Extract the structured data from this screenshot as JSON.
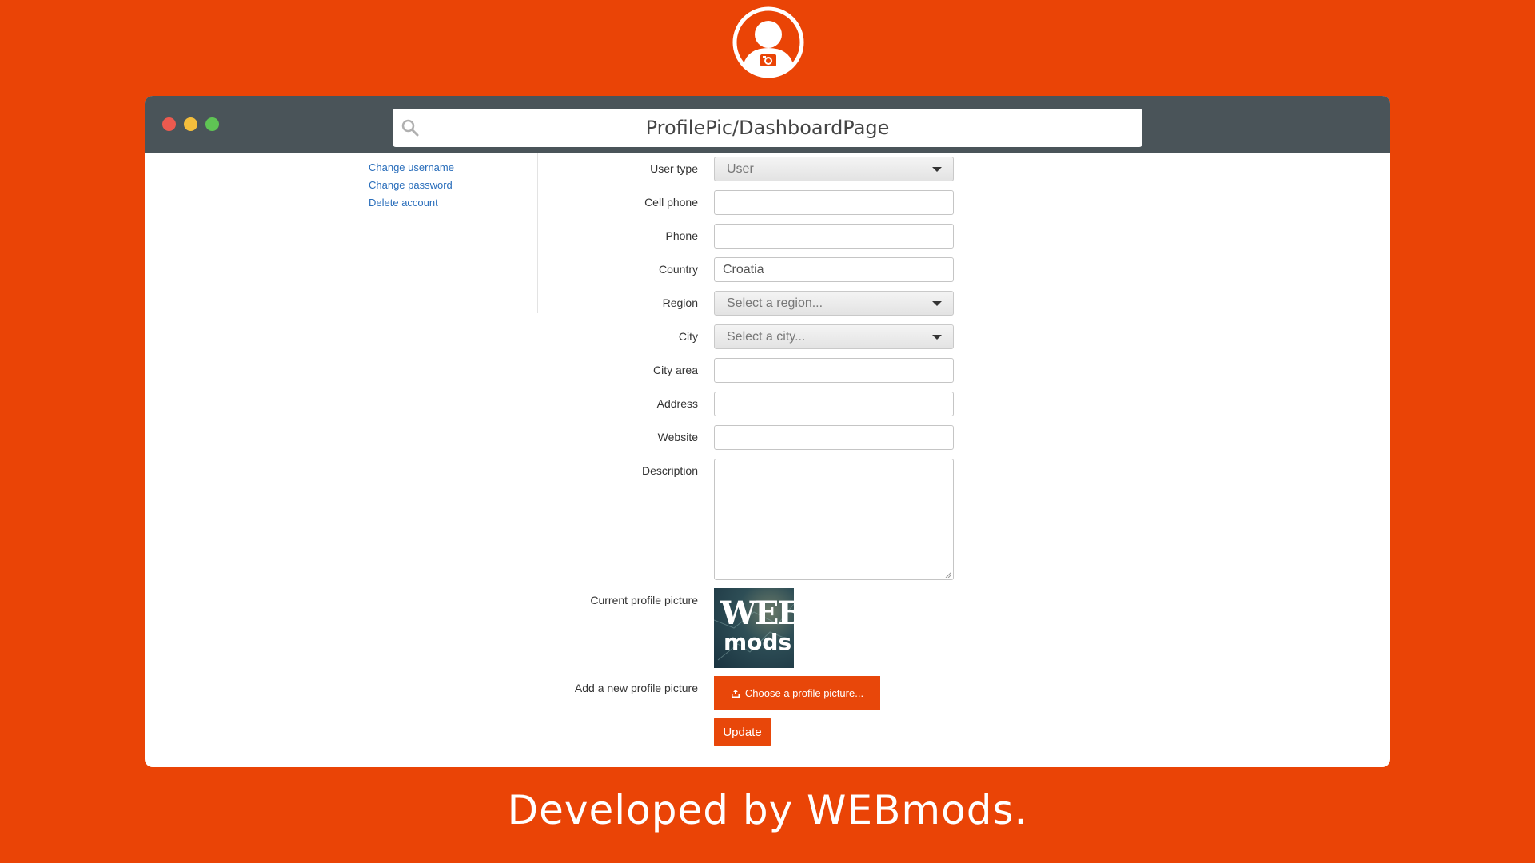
{
  "browser": {
    "url": "ProfilePic/DashboardPage"
  },
  "sidebar": {
    "links": [
      {
        "label": "Change username"
      },
      {
        "label": "Change password"
      },
      {
        "label": "Delete account"
      }
    ]
  },
  "form": {
    "user_type": {
      "label": "User type",
      "value": "User"
    },
    "cell_phone": {
      "label": "Cell phone",
      "value": ""
    },
    "phone": {
      "label": "Phone",
      "value": ""
    },
    "country": {
      "label": "Country",
      "value": "Croatia"
    },
    "region": {
      "label": "Region",
      "value": "Select a region..."
    },
    "city": {
      "label": "City",
      "value": "Select a city..."
    },
    "city_area": {
      "label": "City area",
      "value": ""
    },
    "address": {
      "label": "Address",
      "value": ""
    },
    "website": {
      "label": "Website",
      "value": ""
    },
    "description": {
      "label": "Description",
      "value": ""
    },
    "current_picture": {
      "label": "Current profile picture",
      "image_text_1": "WEB",
      "image_text_2": "mods"
    },
    "new_picture": {
      "label": "Add a new profile picture",
      "button": "Choose a profile picture..."
    },
    "update_button": "Update"
  },
  "footer": {
    "text": "Developed by WEBmods."
  },
  "colors": {
    "background": "#ea4406",
    "titlebar": "#4a5459",
    "accent": "#e8470a",
    "link": "#2a6ebb"
  }
}
